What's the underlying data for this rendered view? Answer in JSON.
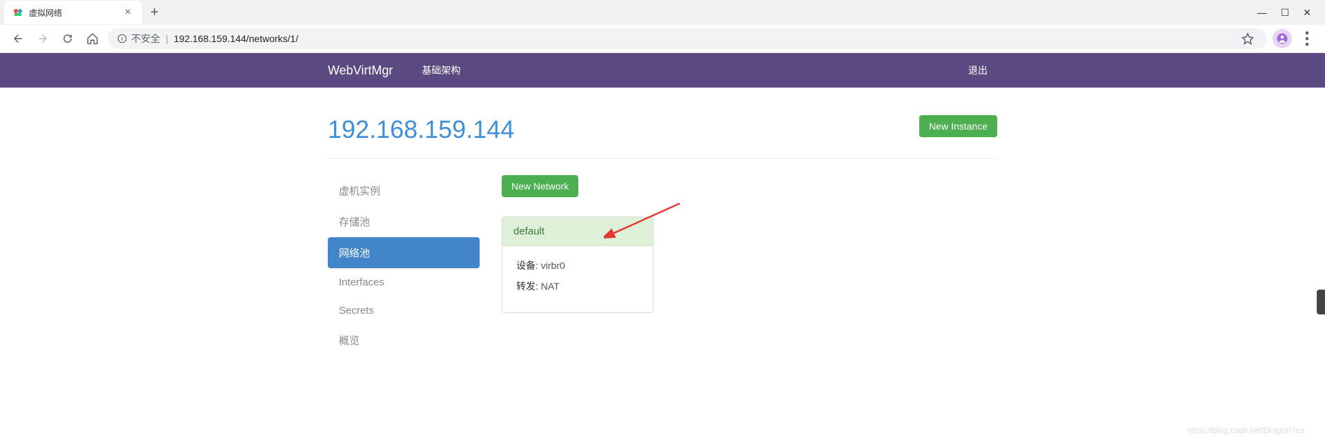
{
  "browser": {
    "tab_title": "虚拟网络",
    "insecure_label": "不安全",
    "url": "192.168.159.144/networks/1/"
  },
  "navbar": {
    "brand": "WebVirtMgr",
    "link_infra": "基础架构",
    "link_logout": "退出"
  },
  "header": {
    "title": "192.168.159.144",
    "new_instance": "New Instance"
  },
  "sidebar": {
    "items": [
      {
        "label": "虚机实例",
        "active": false
      },
      {
        "label": "存储池",
        "active": false
      },
      {
        "label": "网络池",
        "active": true
      },
      {
        "label": "Interfaces",
        "active": false
      },
      {
        "label": "Secrets",
        "active": false
      },
      {
        "label": "概览",
        "active": false
      }
    ]
  },
  "content": {
    "new_network": "New Network",
    "network": {
      "name": "default",
      "device_label": "设备:",
      "device_value": "virbr0",
      "forward_label": "转发:",
      "forward_value": "NAT"
    }
  },
  "watermark": "https://blog.csdn.net/Dragon7es"
}
